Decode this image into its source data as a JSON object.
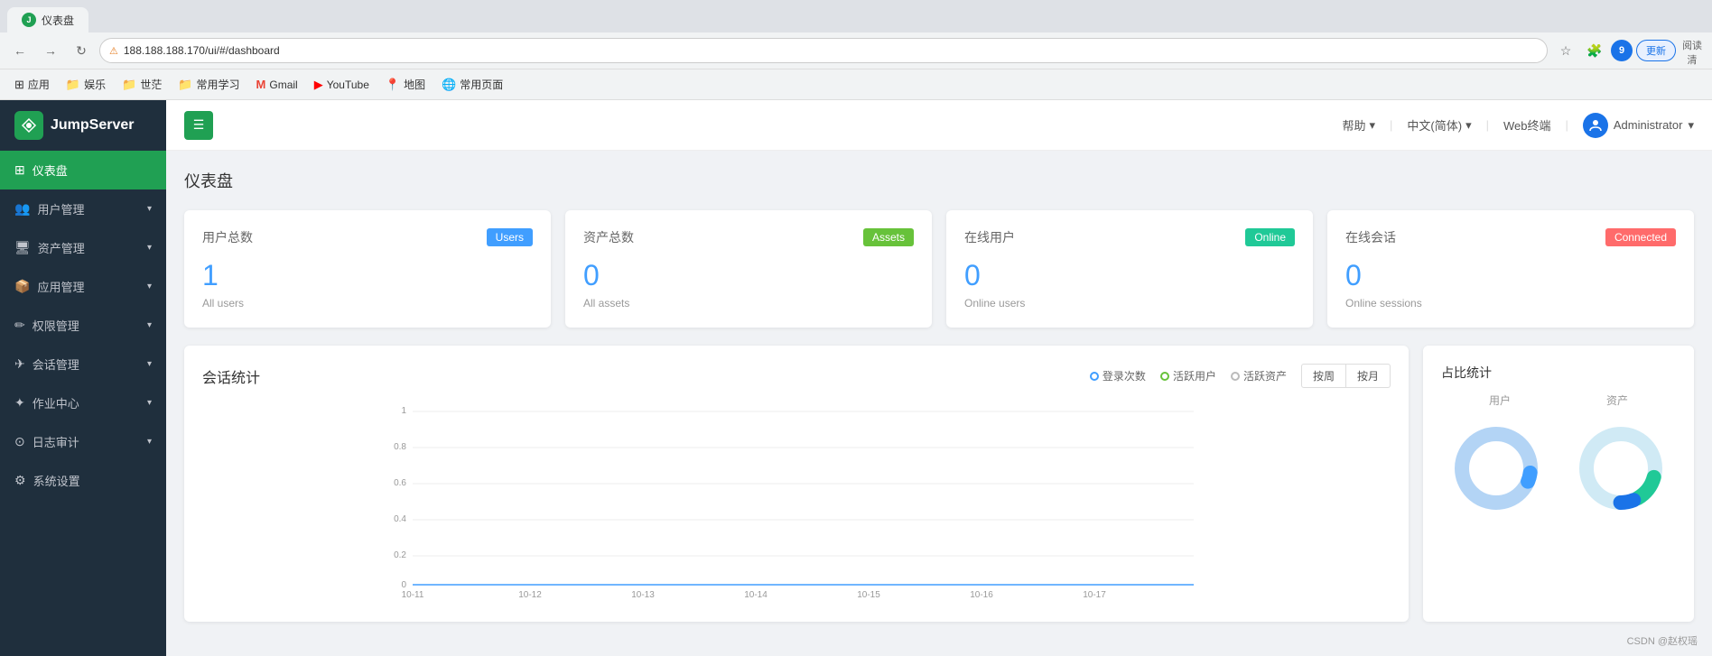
{
  "browser": {
    "tab_icon": "J",
    "tab_title": "仪表盘",
    "back_btn": "←",
    "forward_btn": "→",
    "refresh_btn": "↻",
    "address": "188.188.188.170/ui/#/dashboard",
    "lock_symbol": "⚠",
    "star_symbol": "☆",
    "ext_symbol": "🧩",
    "user_initial": "9",
    "update_label": "更新",
    "reader_label": "阅读清",
    "bookmarks": [
      {
        "icon": "⊞",
        "label": "应用"
      },
      {
        "icon": "📁",
        "label": "娱乐"
      },
      {
        "icon": "📁",
        "label": "世茫"
      },
      {
        "icon": "📁",
        "label": "常用学习"
      },
      {
        "icon": "M",
        "label": "Gmail"
      },
      {
        "icon": "▶",
        "label": "YouTube"
      },
      {
        "icon": "📍",
        "label": "地图"
      },
      {
        "icon": "🌐",
        "label": "常用页面"
      }
    ]
  },
  "sidebar": {
    "logo_text": "JumpServer",
    "menu_items": [
      {
        "icon": "⊞",
        "label": "仪表盘",
        "has_arrow": false,
        "active": true
      },
      {
        "icon": "👥",
        "label": "用户管理",
        "has_arrow": true,
        "active": false
      },
      {
        "icon": "🖥",
        "label": "资产管理",
        "has_arrow": true,
        "active": false
      },
      {
        "icon": "📦",
        "label": "应用管理",
        "has_arrow": true,
        "active": false
      },
      {
        "icon": "🔑",
        "label": "权限管理",
        "has_arrow": true,
        "active": false
      },
      {
        "icon": "💬",
        "label": "会话管理",
        "has_arrow": true,
        "active": false
      },
      {
        "icon": "📋",
        "label": "作业中心",
        "has_arrow": true,
        "active": false
      },
      {
        "icon": "📊",
        "label": "日志审计",
        "has_arrow": true,
        "active": false
      },
      {
        "icon": "⚙",
        "label": "系统设置",
        "has_arrow": false,
        "active": false
      }
    ]
  },
  "topbar": {
    "menu_toggle": "☰",
    "help_label": "帮助",
    "lang_label": "中文(简体)",
    "web_label": "Web终端",
    "admin_label": "Administrator"
  },
  "page": {
    "title": "仪表盘"
  },
  "stats": [
    {
      "label": "用户总数",
      "badge": "Users",
      "badge_class": "badge-users",
      "value": "1",
      "sub": "All users"
    },
    {
      "label": "资产总数",
      "badge": "Assets",
      "badge_class": "badge-assets",
      "value": "0",
      "sub": "All assets"
    },
    {
      "label": "在线用户",
      "badge": "Online",
      "badge_class": "badge-online",
      "value": "0",
      "sub": "Online users"
    },
    {
      "label": "在线会话",
      "badge": "Connected",
      "badge_class": "badge-connected",
      "value": "0",
      "sub": "Online sessions"
    }
  ],
  "chart": {
    "title": "会话统计",
    "legend": [
      {
        "label": "登录次数",
        "class": "legend-dot-login"
      },
      {
        "label": "活跃用户",
        "class": "legend-dot-active-user"
      },
      {
        "label": "活跃资产",
        "class": "legend-dot-active-asset"
      }
    ],
    "btn_week": "按周",
    "btn_month": "按月",
    "y_labels": [
      "1",
      "0.8",
      "0.6",
      "0.4",
      "0.2",
      "0"
    ],
    "x_labels": [
      "10-11",
      "10-12",
      "10-13",
      "10-14",
      "10-15",
      "10-16",
      "10-17"
    ]
  },
  "donut": {
    "title": "占比统计",
    "user_label": "用户",
    "asset_label": "资产"
  },
  "watermark": "CSDN @赵权瑶"
}
